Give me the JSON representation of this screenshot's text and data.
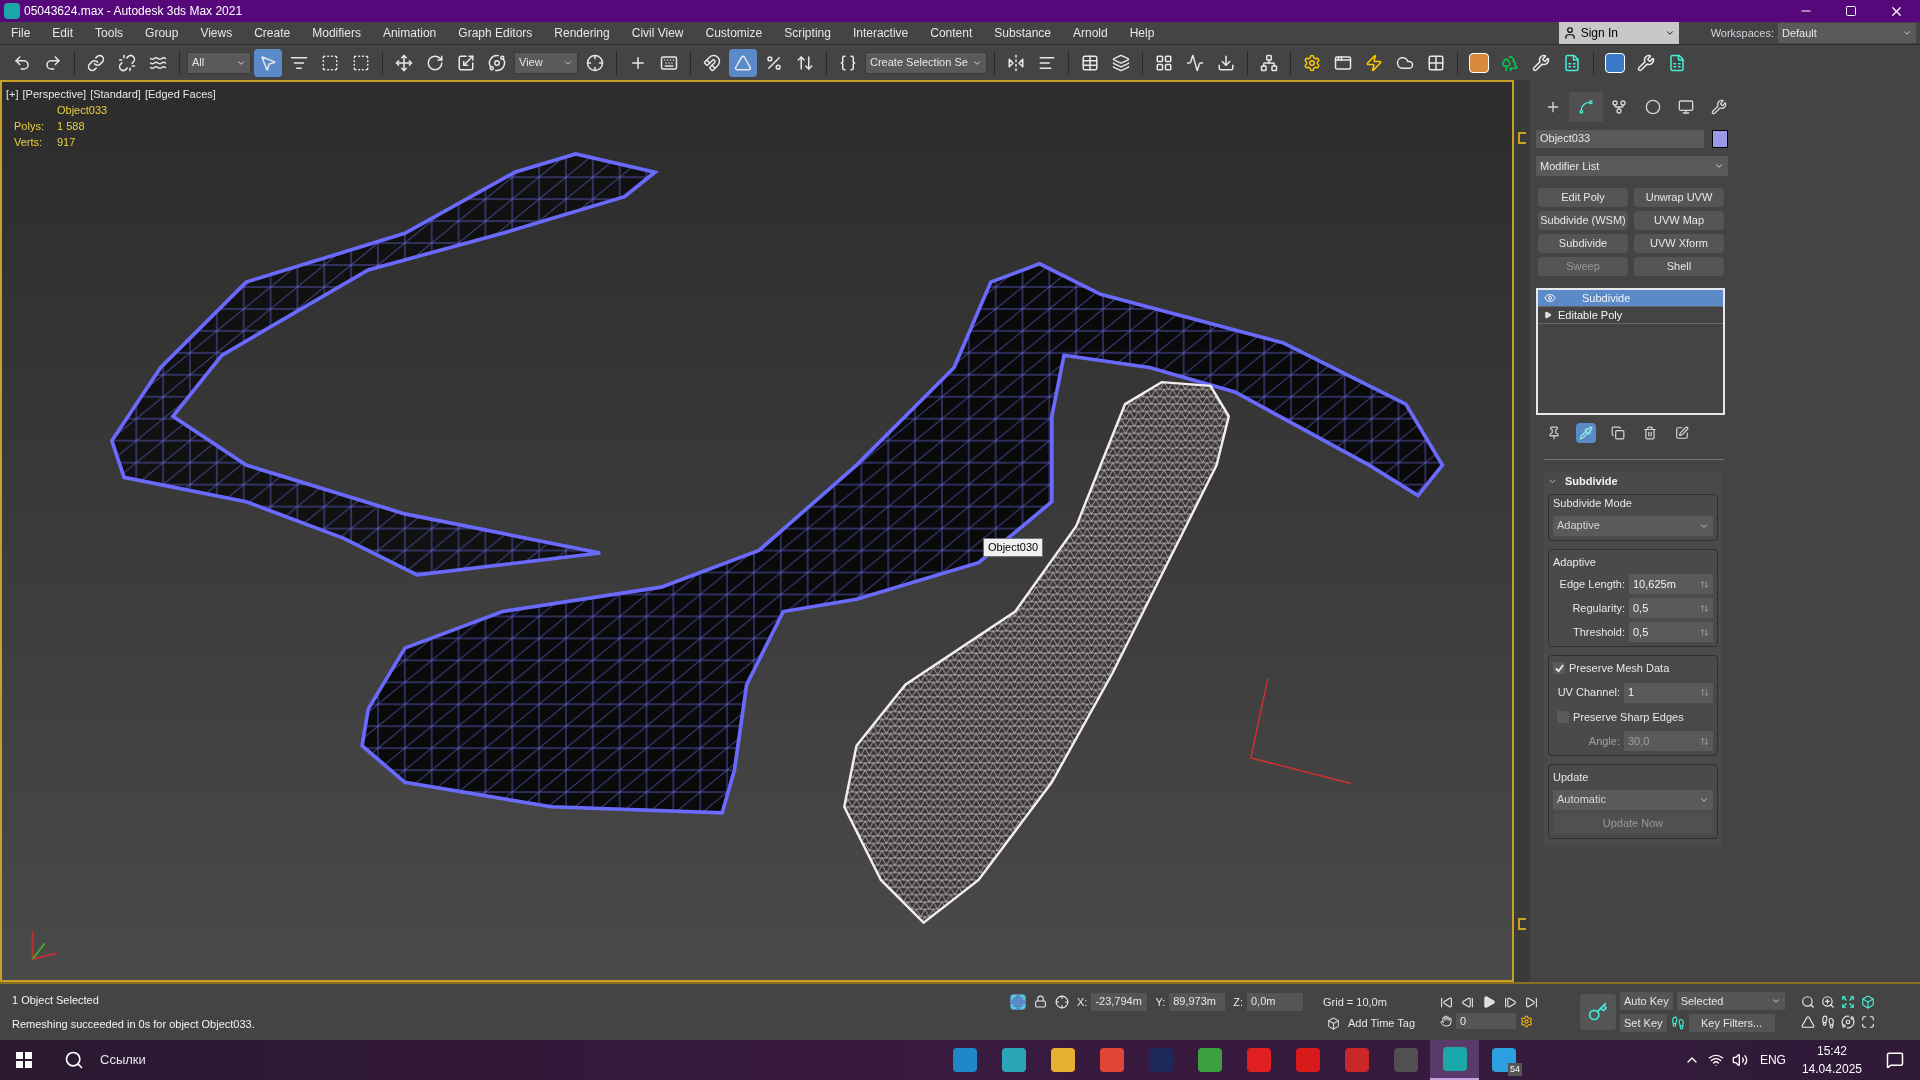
{
  "window": {
    "title": "05043624.max - Autodesk 3ds Max 2021"
  },
  "menu": [
    "File",
    "Edit",
    "Tools",
    "Group",
    "Views",
    "Create",
    "Modifiers",
    "Animation",
    "Graph Editors",
    "Rendering",
    "Civil View",
    "Customize",
    "Scripting",
    "Interactive",
    "Content",
    "Substance",
    "Arnold",
    "Help"
  ],
  "account": {
    "sign_in": "Sign In",
    "workspaces_label": "Workspaces:",
    "workspace": "Default"
  },
  "toolbar": [
    {
      "kind": "undo",
      "active": false
    },
    {
      "kind": "redo",
      "active": false
    },
    {
      "kind": "sep"
    },
    {
      "kind": "link",
      "active": false
    },
    {
      "kind": "unlink",
      "active": false
    },
    {
      "kind": "bind",
      "active": false
    },
    {
      "kind": "sep"
    },
    {
      "kind": "dropdown",
      "value": "All"
    },
    {
      "kind": "select",
      "active": true
    },
    {
      "kind": "select-by-name",
      "active": false
    },
    {
      "kind": "region",
      "active": false
    },
    {
      "kind": "window-crossing",
      "active": false
    },
    {
      "kind": "sep"
    },
    {
      "kind": "move",
      "active": false
    },
    {
      "kind": "rotate",
      "active": false
    },
    {
      "kind": "scale",
      "active": false
    },
    {
      "kind": "place",
      "active": false
    },
    {
      "kind": "dropdown",
      "value": "View"
    },
    {
      "kind": "pivot",
      "active": false
    },
    {
      "kind": "sep"
    },
    {
      "kind": "manipulate",
      "active": false
    },
    {
      "kind": "keyboard",
      "active": false
    },
    {
      "kind": "sep"
    },
    {
      "kind": "snap",
      "active": false
    },
    {
      "kind": "angle-snap",
      "active": true
    },
    {
      "kind": "percent-snap",
      "active": false
    },
    {
      "kind": "spinner-snap",
      "active": false
    },
    {
      "kind": "sep"
    },
    {
      "kind": "named-sets",
      "active": false
    },
    {
      "kind": "dropdown",
      "value": "Create Selection Se"
    },
    {
      "kind": "sep"
    },
    {
      "kind": "mirror",
      "active": false
    },
    {
      "kind": "align",
      "active": false
    },
    {
      "kind": "sep"
    },
    {
      "kind": "explorer",
      "active": false
    },
    {
      "kind": "layers",
      "active": false
    },
    {
      "kind": "sep"
    },
    {
      "kind": "ribbon",
      "active": false
    },
    {
      "kind": "curves",
      "active": false
    },
    {
      "kind": "dope",
      "active": false
    },
    {
      "kind": "sep"
    },
    {
      "kind": "schematic",
      "active": false
    },
    {
      "kind": "sep"
    },
    {
      "kind": "render-setup",
      "active": false
    },
    {
      "kind": "frame-window",
      "active": false
    },
    {
      "kind": "render",
      "active": false
    },
    {
      "kind": "cloud",
      "active": false
    },
    {
      "kind": "gallery",
      "active": false
    },
    {
      "kind": "sep"
    },
    {
      "kind": "plugin-tile",
      "active": false
    },
    {
      "kind": "trees",
      "active": false
    },
    {
      "kind": "tools",
      "active": false
    },
    {
      "kind": "sheet",
      "active": false
    },
    {
      "kind": "sep"
    },
    {
      "kind": "plugin-tile-blue",
      "active": false
    },
    {
      "kind": "tools",
      "active": false
    },
    {
      "kind": "sheet",
      "active": false
    }
  ],
  "viewport": {
    "labels": [
      "[+]",
      "[Perspective]",
      "[Standard]",
      "[Edged Faces]"
    ],
    "object_name": "Object033",
    "stats": [
      {
        "label": "Polys:",
        "value": "1 588"
      },
      {
        "label": "Verts:",
        "value": "917"
      }
    ],
    "tooltip": "Object030"
  },
  "command_panel": {
    "tabs": [
      {
        "kind": "create",
        "selected": false
      },
      {
        "kind": "modify",
        "selected": true
      },
      {
        "kind": "hierarchy",
        "selected": false
      },
      {
        "kind": "motion",
        "selected": false
      },
      {
        "kind": "display",
        "selected": false
      },
      {
        "kind": "utilities",
        "selected": false
      }
    ],
    "object_name": "Object033",
    "modifier_list": "Modifier List",
    "buttons": [
      {
        "label": "Edit Poly",
        "disabled": false
      },
      {
        "label": "Unwrap UVW",
        "disabled": false
      },
      {
        "label": "Subdivide (WSM)",
        "disabled": false
      },
      {
        "label": "UVW Map",
        "disabled": false
      },
      {
        "label": "Subdivide",
        "disabled": false
      },
      {
        "label": "UVW Xform",
        "disabled": false
      },
      {
        "label": "Sweep",
        "disabled": true
      },
      {
        "label": "Shell",
        "disabled": false
      }
    ],
    "stack": [
      {
        "kind": "modifier",
        "label": "Subdivide",
        "selected": true
      },
      {
        "kind": "object",
        "label": "Editable Poly",
        "selected": false
      }
    ],
    "stack_tools": [
      {
        "kind": "pin",
        "active": false
      },
      {
        "kind": "show-result",
        "active": true
      },
      {
        "kind": "unique",
        "active": false
      },
      {
        "kind": "remove",
        "active": false
      },
      {
        "kind": "configure",
        "active": false
      }
    ],
    "rollout": {
      "title": "Subdivide",
      "expanded": true,
      "mode_label": "Subdivide Mode",
      "mode": "Adaptive",
      "adaptive_label": "Adaptive",
      "fields": [
        {
          "label": "Edge Length:",
          "value": "10,625m"
        },
        {
          "label": "Regularity:",
          "value": "0,5"
        },
        {
          "label": "Threshold:",
          "value": "0,5"
        }
      ],
      "preserve_mesh": {
        "label": "Preserve Mesh Data",
        "checked": true
      },
      "uv_channel": {
        "label": "UV Channel:",
        "value": "1"
      },
      "sharp_edges": {
        "label": "Preserve Sharp Edges",
        "checked": false
      },
      "angle": {
        "label": "Angle:",
        "value": "30,0",
        "disabled": true
      },
      "update_label": "Update",
      "update_mode": "Automatic",
      "update_now": {
        "label": "Update Now",
        "disabled": true
      }
    }
  },
  "status": {
    "selection": "1 Object Selected",
    "prompt": "Remeshing succeeded in 0s for object Object033.",
    "coords": [
      {
        "label": "X:",
        "value": "-23,794m"
      },
      {
        "label": "Y:",
        "value": "89,973m"
      },
      {
        "label": "Z:",
        "value": "0,0m"
      }
    ],
    "grid": "Grid = 10,0m",
    "time_tag": "Add Time Tag",
    "frame": "0",
    "auto_key": "Auto Key",
    "set_key": "Set Key",
    "key_set": "Selected",
    "key_filters": "Key Filters..."
  },
  "taskbar": {
    "search": "Ссылки",
    "apps": [
      {
        "color": "#1e88c8",
        "selected": false
      },
      {
        "color": "#2aa6b8",
        "selected": false
      },
      {
        "color": "#e8b030",
        "selected": false
      },
      {
        "color": "#e04434",
        "selected": false
      },
      {
        "color": "#1c2a5a",
        "selected": false
      },
      {
        "color": "#3aa040",
        "selected": false
      },
      {
        "color": "#e02020",
        "selected": false
      },
      {
        "color": "#d81a1a",
        "selected": false
      },
      {
        "color": "#c82828",
        "selected": false
      },
      {
        "color": "#505050",
        "selected": false
      },
      {
        "color": "#1ba8a8",
        "selected": true
      },
      {
        "color": "#2aa0e0",
        "selected": false
      }
    ],
    "badge": "54",
    "lang": "ENG",
    "time": "15:42",
    "date": "14.04.2025"
  }
}
